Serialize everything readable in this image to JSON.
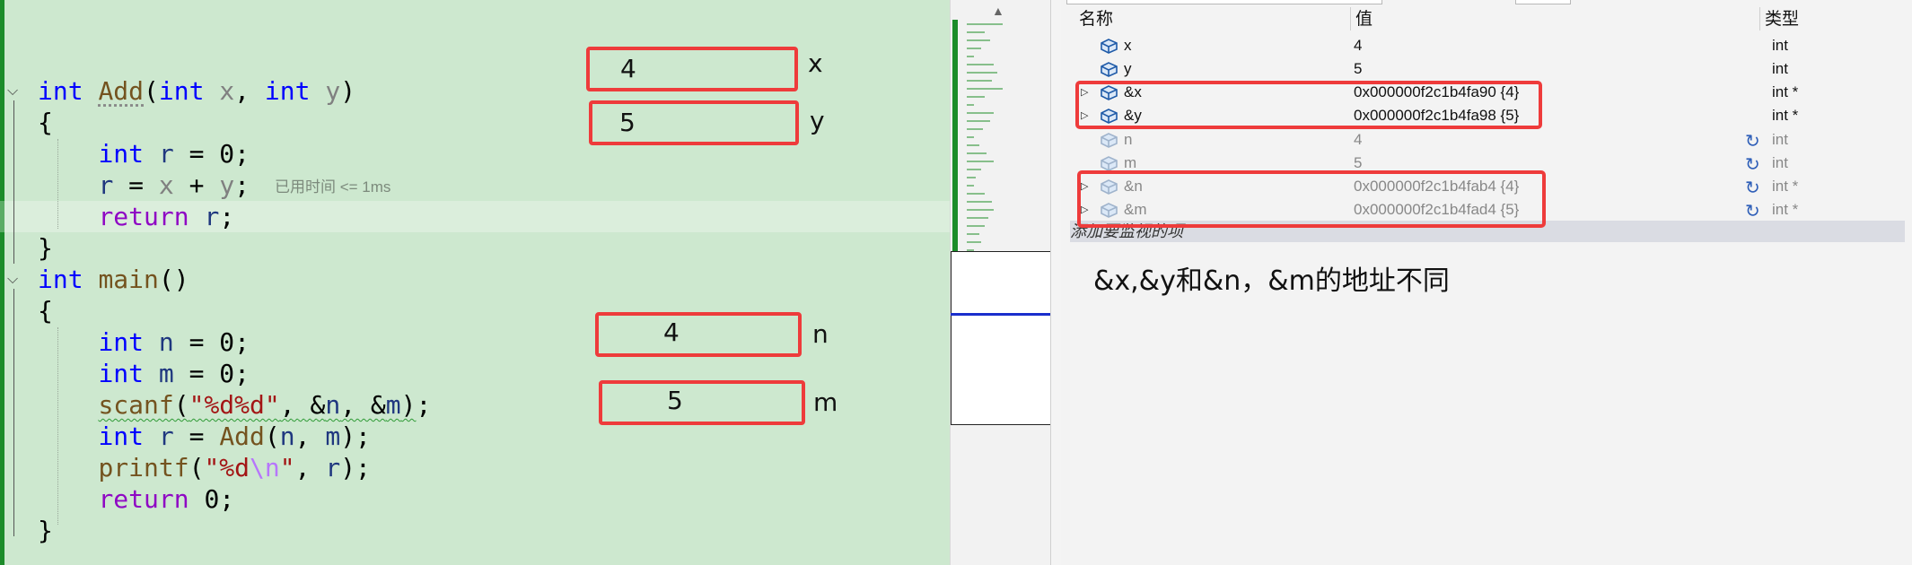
{
  "editor": {
    "lines": [
      [
        [
          "kw",
          "int"
        ],
        [
          "",
          " "
        ],
        [
          "fn dotted",
          "Add"
        ],
        [
          "",
          "("
        ],
        [
          "kw",
          "int"
        ],
        [
          "",
          " "
        ],
        [
          "pm",
          "x"
        ],
        [
          "",
          ", "
        ],
        [
          "kw",
          "int"
        ],
        [
          "",
          " "
        ],
        [
          "pm",
          "y"
        ],
        [
          "",
          ")"
        ]
      ],
      [
        [
          "",
          "{"
        ]
      ],
      [
        [
          "",
          "    "
        ],
        [
          "kw",
          "int"
        ],
        [
          "",
          " "
        ],
        [
          "lv",
          "r"
        ],
        [
          "",
          " = 0;"
        ]
      ],
      [
        [
          "",
          "    "
        ],
        [
          "lv",
          "r"
        ],
        [
          "",
          " = "
        ],
        [
          "pm",
          "x"
        ],
        [
          "",
          " + "
        ],
        [
          "pm",
          "y"
        ],
        [
          "",
          ";"
        ]
      ],
      [
        [
          "",
          "    "
        ],
        [
          "ctl",
          "return"
        ],
        [
          "",
          " "
        ],
        [
          "lv",
          "r"
        ],
        [
          "",
          ";"
        ]
      ],
      [
        [
          "",
          "}"
        ]
      ],
      [
        [
          "kw",
          "int"
        ],
        [
          "",
          " "
        ],
        [
          "fn",
          "main"
        ],
        [
          "",
          "()"
        ]
      ],
      [
        [
          "",
          "{"
        ]
      ],
      [
        [
          "",
          "    "
        ],
        [
          "kw",
          "int"
        ],
        [
          "",
          " "
        ],
        [
          "lv",
          "n"
        ],
        [
          "",
          " = 0;"
        ]
      ],
      [
        [
          "",
          "    "
        ],
        [
          "kw",
          "int"
        ],
        [
          "",
          " "
        ],
        [
          "lv",
          "m"
        ],
        [
          "",
          " = 0;"
        ]
      ],
      [
        [
          "",
          "    "
        ],
        [
          "fn squig",
          "scanf"
        ],
        [
          "squig",
          "("
        ],
        [
          "str squig",
          "\"%d%d\""
        ],
        [
          "squig",
          ", &"
        ],
        [
          "lv squig",
          "n"
        ],
        [
          "squig",
          ", &"
        ],
        [
          "lv squig",
          "m"
        ],
        [
          "squig",
          ")"
        ],
        [
          "",
          ";"
        ]
      ],
      [
        [
          "",
          "    "
        ],
        [
          "kw",
          "int"
        ],
        [
          "",
          " "
        ],
        [
          "lv",
          "r"
        ],
        [
          "",
          " = "
        ],
        [
          "fn",
          "Add"
        ],
        [
          "",
          "("
        ],
        [
          "lv",
          "n"
        ],
        [
          "",
          ", "
        ],
        [
          "lv",
          "m"
        ],
        [
          "",
          ");"
        ]
      ],
      [
        [
          "",
          "    "
        ],
        [
          "fn",
          "printf"
        ],
        [
          "",
          "("
        ],
        [
          "str",
          "\"%d"
        ],
        [
          "esc",
          "\\n"
        ],
        [
          "str",
          "\""
        ],
        [
          "",
          ", "
        ],
        [
          "lv",
          "r"
        ],
        [
          "",
          ");"
        ]
      ],
      [
        [
          "",
          "    "
        ],
        [
          "ctl",
          "return"
        ],
        [
          "",
          " 0;"
        ]
      ],
      [
        [
          "",
          "}"
        ]
      ]
    ],
    "timing_hint": "已用时间 <= 1ms",
    "annotations": {
      "x_value": "4",
      "x_label": "x",
      "y_value": "5",
      "y_label": "y",
      "n_value": "4",
      "n_label": "n",
      "m_value": "5",
      "m_label": "m"
    }
  },
  "watch": {
    "columns": {
      "name": "名称",
      "value": "值",
      "type": "类型"
    },
    "rows": [
      {
        "name": "x",
        "value": "4",
        "type": "int"
      },
      {
        "name": "y",
        "value": "5",
        "type": "int"
      },
      {
        "name": "&x",
        "value": "0x000000f2c1b4fa90 {4}",
        "type": "int *"
      },
      {
        "name": "&y",
        "value": "0x000000f2c1b4fa98 {5}",
        "type": "int *"
      },
      {
        "name": "n",
        "value": "4",
        "type": "int"
      },
      {
        "name": "m",
        "value": "5",
        "type": "int"
      },
      {
        "name": "&n",
        "value": "0x000000f2c1b4fab4 {4}",
        "type": "int *"
      },
      {
        "name": "&m",
        "value": "0x000000f2c1b4fad4 {5}",
        "type": "int *"
      }
    ],
    "add_item_placeholder": "添加要监视的项",
    "note": "&x,&y和&n，&m的地址不同"
  },
  "colors": {
    "editor_bg": "#cde8cf",
    "highlight_box": "#ee3b3b",
    "change_bar": "#1c8c2a"
  }
}
